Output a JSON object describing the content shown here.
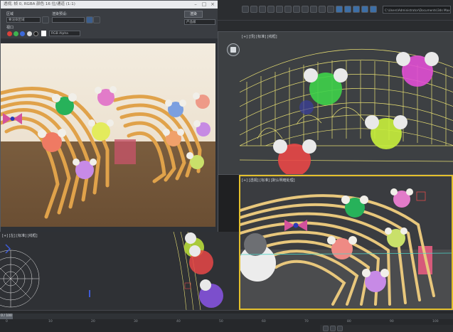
{
  "render_window": {
    "title": "透视, 帧 0, RGBA 颜色 16 位/通道 (1:1)",
    "area_label": "区域",
    "area_value": "要渲染区域",
    "preset_label": "渲染预设:",
    "preset_value": "",
    "viewport_label": "视口",
    "viewport_value": "四元菜单 4 - 透视",
    "render_button": "渲染",
    "production_value": "产品级",
    "channel_value": "RGB Alpha",
    "swatches": [
      "#d9413a",
      "#3fb34f",
      "#3b68d8",
      "#d8d8d8",
      "#1b1b1b",
      "#ffffff"
    ]
  },
  "main_toolbar": {
    "path": "C:\\Users\\Administrator\\Documents\\3ds Max 2020",
    "icons": [
      "select-icon",
      "move-icon",
      "rotate-icon",
      "scale-icon",
      "snap-icon",
      "angle-snap-icon",
      "percent-snap-icon",
      "mirror-icon",
      "align-icon",
      "layer-icon",
      "curve-editor-icon",
      "schematic-icon",
      "material-editor-icon",
      "render-setup-icon",
      "render-frame-icon",
      "render-icon"
    ]
  },
  "viewports": {
    "top_label": "[+] [顶] [标准] [线框]",
    "persp_label": "[+] [透视] [标准] [默认明暗处理]",
    "left_label": "[+] [左] [标准] [线框]"
  },
  "timeline": {
    "ticks": [
      "0",
      "10",
      "20",
      "30",
      "40",
      "50",
      "60",
      "70",
      "80",
      "90",
      "100"
    ],
    "frame_readout": "0 / 100"
  }
}
